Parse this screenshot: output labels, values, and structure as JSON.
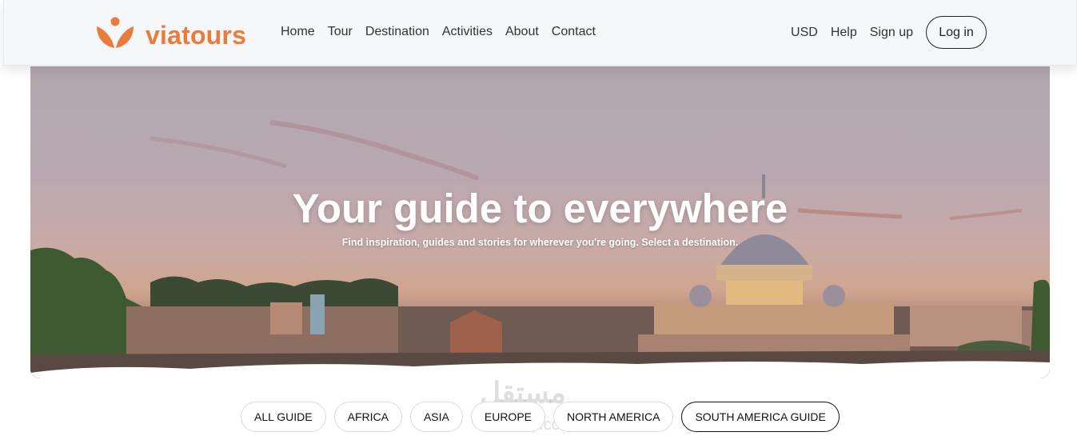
{
  "brand": {
    "name": "viatours",
    "color": "#eb7a3d",
    "logo_icon": "heart-person-icon"
  },
  "nav": {
    "items": [
      {
        "label": "Home"
      },
      {
        "label": "Tour"
      },
      {
        "label": "Destination"
      },
      {
        "label": "Activities"
      },
      {
        "label": "About"
      },
      {
        "label": "Contact"
      }
    ]
  },
  "header_right": {
    "currency": "USD",
    "help": "Help",
    "signup": "Sign up",
    "login": "Log in"
  },
  "hero": {
    "title": "Your guide to everywhere",
    "subtitle": "Find inspiration, guides and stories for wherever you're going. Select a destination."
  },
  "filters": {
    "selected": "SOUTH AMERICA GUIDE",
    "items": [
      {
        "label": "ALL GUIDE"
      },
      {
        "label": "AFRICA"
      },
      {
        "label": "ASIA"
      },
      {
        "label": "EUROPE"
      },
      {
        "label": "NORTH AMERICA"
      },
      {
        "label": "SOUTH AMERICA GUIDE"
      }
    ]
  },
  "watermark": {
    "text": "مستقل",
    "sub": "mostaql.com"
  }
}
